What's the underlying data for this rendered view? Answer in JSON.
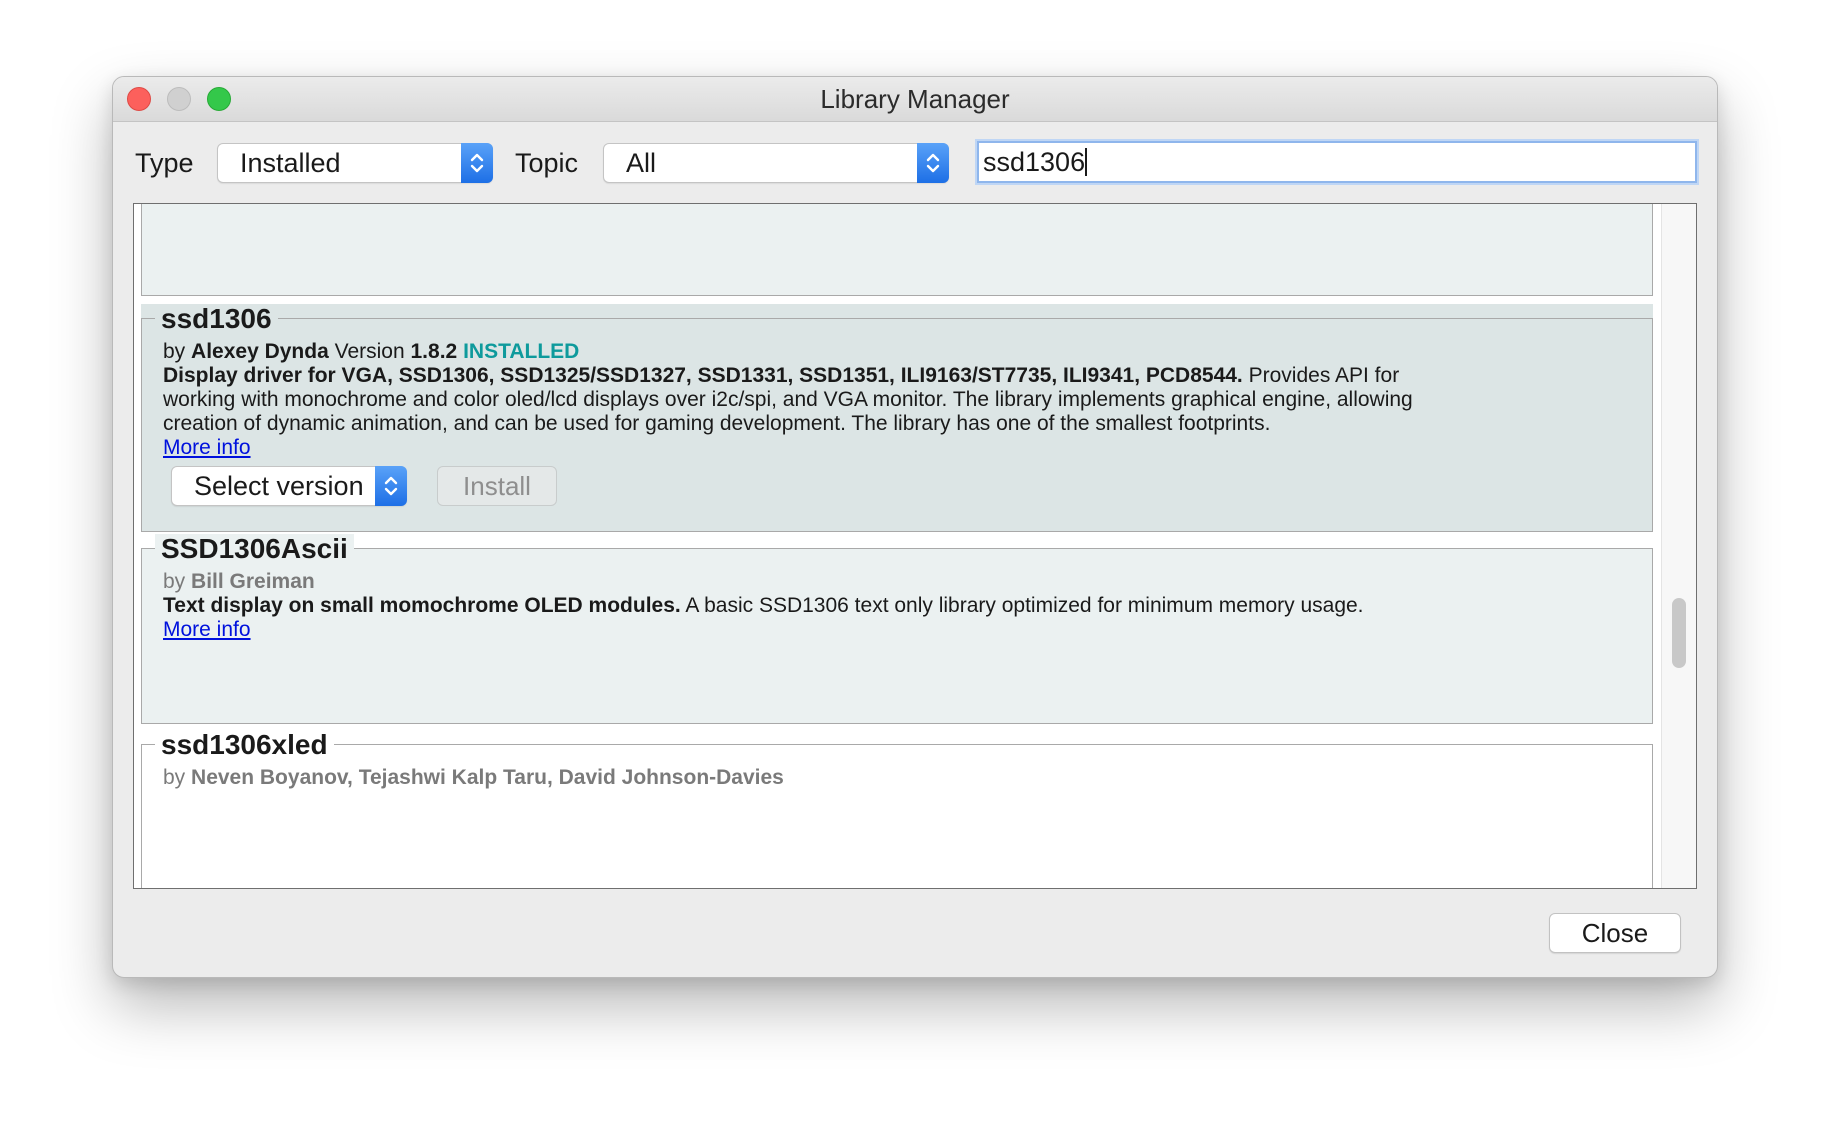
{
  "window": {
    "title": "Library Manager"
  },
  "filters": {
    "type_label": "Type",
    "type_value": "Installed",
    "topic_label": "Topic",
    "topic_value": "All",
    "search_value": "ssd1306"
  },
  "libraries": [
    {
      "name": "ssd1306",
      "by": "by",
      "author": "Alexey Dynda",
      "version_label": "Version",
      "version": "1.8.2",
      "status": "INSTALLED",
      "summary": "Display driver for VGA, SSD1306, SSD1325/SSD1327, SSD1331, SSD1351, ILI9163/ST7735, ILI9341, PCD8544.",
      "description_1": " Provides API for",
      "description_2": "working with monochrome and color oled/lcd displays over i2c/spi, and VGA monitor. The library implements graphical engine, allowing",
      "description_3": "creation of dynamic animation, and can be used for gaming development. The library has one of the smallest footprints.",
      "more_info": "More info",
      "select_version": "Select version",
      "install": "Install"
    },
    {
      "name": "SSD1306Ascii",
      "by": "by",
      "author": "Bill Greiman",
      "summary": "Text display on small momochrome OLED modules.",
      "description_1": " A basic SSD1306 text only library optimized for minimum memory usage.",
      "more_info": "More info"
    },
    {
      "name": "ssd1306xled",
      "by": "by",
      "author": "Neven Boyanov, Tejashwi Kalp Taru, David Johnson-Davies"
    }
  ],
  "footer": {
    "close_label": "Close"
  },
  "colors": {
    "installed": "#0e9a9c",
    "link": "#0011dd",
    "selected_entry_bg": "#dce5e5",
    "entry_bg": "#ebf1f1",
    "select_arrow": "#1d6fe6"
  }
}
